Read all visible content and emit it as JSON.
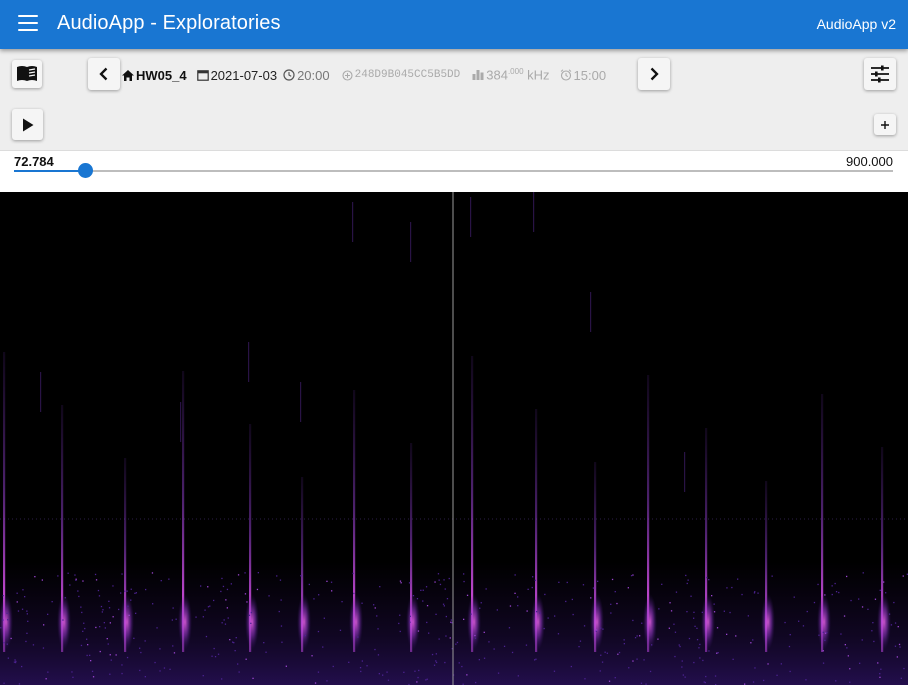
{
  "app": {
    "title": "AudioApp - Exploratories",
    "version": "AudioApp v2"
  },
  "recording": {
    "location": "HW05_4",
    "date": "2021-07-03",
    "time": "20:00",
    "device": "248D9B045CC5B5DD",
    "sample_rate": "384",
    "sample_rate_decimals": ".000",
    "sample_rate_unit": "kHz",
    "duration": "15:00"
  },
  "slider": {
    "value": "72.784",
    "max": "900.000",
    "fraction": 0.0809
  },
  "icons": {
    "menu": "menu-icon",
    "docs": "book-icon",
    "prev": "chevron-left-icon",
    "next": "chevron-right-icon",
    "settings": "tune-icon",
    "play": "play-icon",
    "add": "plus-icon",
    "location": "home-icon",
    "date": "calendar-icon",
    "time": "clock-icon",
    "device": "device-icon",
    "rate": "bar-chart-icon",
    "duration": "alarm-icon"
  },
  "colors": {
    "appbar": "#1976d2",
    "accent": "#1976d2",
    "spectrogram_bg": "#000000",
    "call": "#c43fd6"
  }
}
